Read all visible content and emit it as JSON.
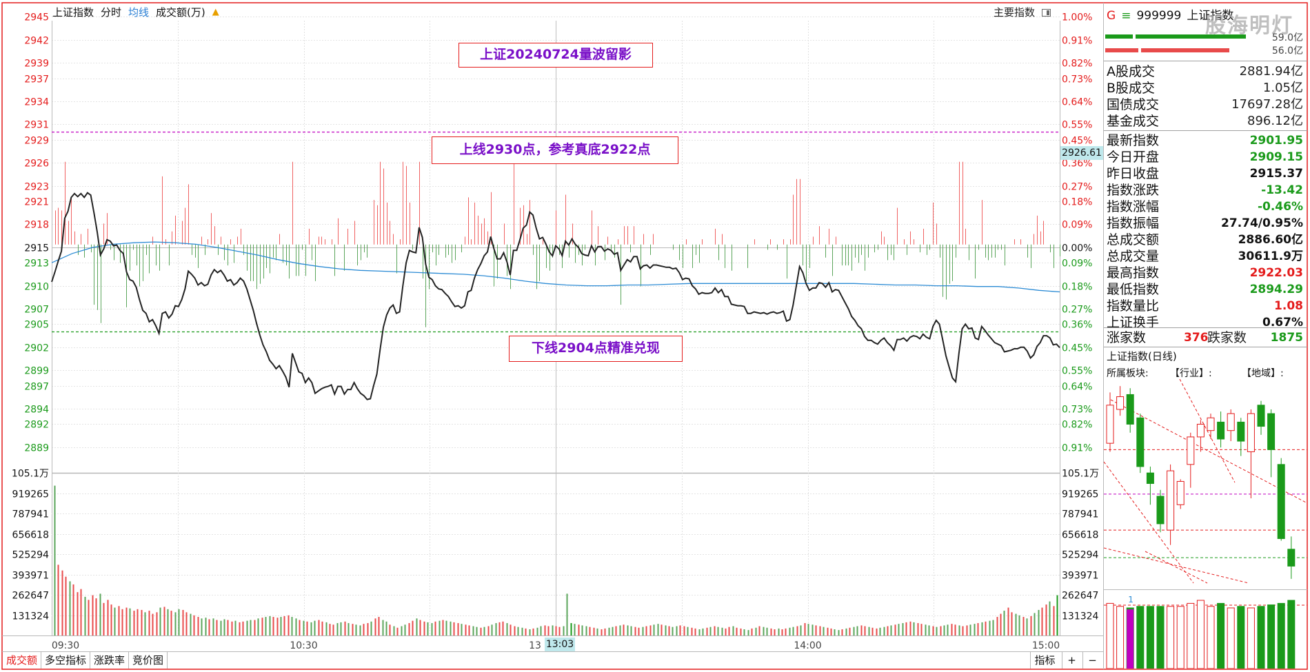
{
  "header": {
    "title": "上证指数",
    "tab_minute": "分时",
    "tab_avg": "均线",
    "tab_volume": "成交额(万)",
    "right_label": "主要指数"
  },
  "annotations": {
    "a1": "上证20240724量波留影",
    "a2": "上线2930点，参考真底2922点",
    "a3": "下线2904点精准兑现"
  },
  "cursor": {
    "price_label": "2926.61",
    "time_label": "13:03"
  },
  "price_ticks": [
    "2945",
    "2942",
    "2939",
    "2937",
    "2934",
    "2931",
    "2929",
    "2926",
    "2923",
    "2921",
    "2918",
    "2915",
    "2913",
    "2910",
    "2907",
    "2905",
    "2902",
    "2899",
    "2897",
    "2894",
    "2892",
    "2889"
  ],
  "pct_ticks": [
    "1.00%",
    "0.91%",
    "0.82%",
    "0.73%",
    "0.64%",
    "0.55%",
    "0.45%",
    "0.36%",
    "0.27%",
    "0.18%",
    "0.09%",
    "0.00%",
    "0.09%",
    "0.18%",
    "0.27%",
    "0.36%",
    "0.45%",
    "0.55%",
    "0.64%",
    "0.73%",
    "0.82%",
    "0.91%"
  ],
  "volume_ticks": [
    "105.1万",
    "919265",
    "787941",
    "656618",
    "525294",
    "393971",
    "262647",
    "131324"
  ],
  "time_ticks": [
    "09:30",
    "10:30",
    "13",
    "14:00",
    "15:00"
  ],
  "chart_data": {
    "type": "line",
    "title": "上证指数",
    "prev_close": 2915.37,
    "ylim": [
      2887.0,
      2944.5
    ],
    "volume_max": 1051000,
    "x_sessions": "09:30-11:30, 13:00-15:00",
    "upper_line": 2930,
    "lower_line": 2904,
    "series": [
      {
        "name": "分时",
        "values": [
          2910.5,
          2911.8,
          2913.2,
          2914.5,
          2918.8,
          2919.7,
          2921.5,
          2922.0,
          2921.6,
          2922.0,
          2921.5,
          2922.1,
          2921.8,
          2919.5,
          2917.0,
          2914.0,
          2914.8,
          2916.0,
          2915.8,
          2915.2,
          2915.3,
          2914.6,
          2914.2,
          2911.8,
          2910.8,
          2910.6,
          2909.8,
          2908.2,
          2906.8,
          2906.4,
          2905.3,
          2905.6,
          2904.8,
          2903.8,
          2906.4,
          2906.6,
          2905.8,
          2906.3,
          2907.4,
          2907.3,
          2908.2,
          2909.6,
          2911.9,
          2911.5,
          2911.0,
          2910.1,
          2910.4,
          2910.0,
          2910.2,
          2911.4,
          2912.1,
          2911.7,
          2912.0,
          2911.4,
          2910.6,
          2910.8,
          2910.1,
          2910.4,
          2911.0,
          2910.6,
          2909.6,
          2908.2,
          2906.8,
          2905.1,
          2903.6,
          2902.3,
          2901.4,
          2900.3,
          2899.8,
          2899.2,
          2899.6,
          2898.9,
          2898.1,
          2896.8,
          2901.2,
          2900.0,
          2898.8,
          2898.6,
          2897.4,
          2898.0,
          2897.4,
          2896.0,
          2896.3,
          2896.6,
          2896.8,
          2896.9,
          2897.1,
          2895.9,
          2896.9,
          2896.9,
          2895.9,
          2896.5,
          2896.5,
          2897.4,
          2896.6,
          2896.0,
          2895.7,
          2895.2,
          2895.3,
          2897.0,
          2898.5,
          2901.7,
          2904.6,
          2906.2,
          2907.1,
          2907.5,
          2906.4,
          2906.6,
          2910.0,
          2913.0,
          2914.6,
          2914.4,
          2914.3,
          2917.6,
          2916.3,
          2912.8,
          2911.1,
          2910.8,
          2910.0,
          2909.6,
          2909.5,
          2909.0,
          2908.6,
          2907.9,
          2907.3,
          2907.4,
          2907.1,
          2907.4,
          2909.2,
          2909.4,
          2911.0,
          2912.1,
          2912.9,
          2913.9,
          2914.4,
          2916.4,
          2914.8,
          2913.5,
          2913.5,
          2914.3,
          2913.1,
          2911.4,
          2914.6,
          2914.6,
          2916.0,
          2917.5,
          2917.9,
          2919.6,
          2919.2,
          2917.5,
          2916.1,
          2916.3,
          2915.4,
          2914.4,
          2913.9,
          2915.2,
          2914.8,
          2913.9,
          2915.8,
          2915.3,
          2916.1,
          2915.4,
          2915.0,
          2914.2,
          2914.0,
          2913.9,
          2915.2,
          2914.4,
          2915.1,
          2915.1,
          2914.5,
          2914.8,
          2914.6,
          2914.1,
          2914.3,
          2912.0,
          2912.7,
          2913.4,
          2913.1,
          2913.8,
          2913.8,
          2912.2,
          2912.6,
          2912.7,
          2912.3,
          2912.7,
          2912.7,
          2912.6,
          2912.5,
          2912.4,
          2912.4,
          2912.2,
          2912.3,
          2911.7,
          2910.8,
          2911.0,
          2910.9,
          2910.0,
          2909.6,
          2908.9,
          2909.1,
          2909.0,
          2909.0,
          2909.1,
          2909.7,
          2909.1,
          2909.5,
          2908.6,
          2908.6,
          2907.6,
          2907.5,
          2907.4,
          2907.4,
          2907.3,
          2906.4,
          2906.4,
          2906.6,
          2906.5,
          2906.4,
          2906.5,
          2906.3,
          2906.5,
          2906.6,
          2906.4,
          2906.5,
          2906.7,
          2905.4,
          2905.6,
          2907.5,
          2910.0,
          2912.5,
          2911.7,
          2910.3,
          2909.4,
          2909.7,
          2909.7,
          2910.4,
          2910.3,
          2909.8,
          2910.4,
          2909.2,
          2909.5,
          2909.4,
          2908.6,
          2907.8,
          2907.0,
          2906.0,
          2905.5,
          2904.8,
          2904.4,
          2903.4,
          2902.9,
          2902.9,
          2902.6,
          2902.4,
          2902.9,
          2903.2,
          2902.6,
          2902.2,
          2901.6,
          2903.0,
          2903.0,
          2903.2,
          2902.8,
          2903.3,
          2903.5,
          2903.4,
          2903.1,
          2903.7,
          2903.3,
          2903.1,
          2904.7,
          2905.5,
          2905.0,
          2903.0,
          2900.9,
          2899.4,
          2898.0,
          2897.5,
          2901.2,
          2904.4,
          2905.0,
          2904.4,
          2904.5,
          2903.2,
          2903.0,
          2904.7,
          2904.2,
          2903.6,
          2903.1,
          2902.6,
          2902.4,
          2902.2,
          2901.4,
          2901.5,
          2901.6,
          2901.8,
          2901.8,
          2902.0,
          2902.0,
          2901.5,
          2900.6,
          2901.0,
          2902.1,
          2902.6,
          2903.5,
          2903.5,
          2903.2,
          2902.3,
          2902.4,
          2901.95
        ]
      },
      {
        "name": "均线",
        "values": [
          2913.0,
          2914.2,
          2915.0,
          2915.4,
          2915.6,
          2915.7,
          2915.6,
          2915.4,
          2915.0,
          2914.5,
          2914.0,
          2913.4,
          2912.9,
          2912.5,
          2912.2,
          2912.0,
          2911.9,
          2911.8,
          2911.7,
          2911.6,
          2911.5,
          2911.3,
          2911.0,
          2910.6,
          2910.3,
          2910.1,
          2910.0,
          2910.0,
          2910.1,
          2910.1,
          2910.2,
          2910.3,
          2910.3,
          2910.3,
          2910.3,
          2910.3,
          2910.3,
          2910.3,
          2910.3,
          2910.3,
          2910.2,
          2910.1,
          2910.1,
          2910.0,
          2910.0,
          2909.9,
          2909.9,
          2909.7,
          2909.4,
          2909.2
        ]
      }
    ],
    "volume_values": [
      968000,
      457000,
      420000,
      380000,
      350000,
      330000,
      280000,
      300000,
      250000,
      230000,
      260000,
      240000,
      270000,
      210000,
      230000,
      200000,
      180000,
      190000,
      170000,
      180000,
      175000,
      160000,
      170000,
      165000,
      150000,
      160000,
      140000,
      150000,
      180000,
      185000,
      170000,
      160000,
      150000,
      170000,
      165000,
      150000,
      140000,
      130000,
      120000,
      110000,
      115000,
      105000,
      110000,
      100000,
      95000,
      105000,
      100000,
      90000,
      95000,
      85000,
      90000,
      95000,
      100000,
      100000,
      110000,
      115000,
      120000,
      125000,
      120000,
      115000,
      120000,
      125000,
      130000,
      120000,
      110000,
      100000,
      95000,
      90000,
      85000,
      95000,
      100000,
      90000,
      85000,
      75000,
      70000,
      80000,
      85000,
      90000,
      80000,
      75000,
      70000,
      65000,
      75000,
      80000,
      90000,
      110000,
      120000,
      100000,
      90000,
      70000,
      60000,
      50000,
      60000,
      70000,
      80000,
      95000,
      110000,
      100000,
      90000,
      85000,
      80000,
      90000,
      95000,
      100000,
      95000,
      90000,
      85000,
      80000,
      75000,
      70000,
      65000,
      60000,
      55000,
      50000,
      55000,
      60000,
      70000,
      80000,
      85000,
      90000,
      80000,
      70000,
      60000,
      55000,
      50000,
      45000,
      40000,
      45000,
      50000,
      60000,
      65000,
      60000,
      65000,
      60000,
      55000,
      60000,
      270000,
      80000,
      75000,
      70000,
      65000,
      60000,
      55000,
      50000,
      45000,
      40000,
      45000,
      50000,
      55000,
      60000,
      65000,
      70000,
      65000,
      60000,
      55000,
      50000,
      55000,
      60000,
      65000,
      70000,
      75000,
      70000,
      65000,
      60000,
      55000,
      60000,
      65000,
      60000,
      55000,
      50000,
      45000,
      40000,
      45000,
      50000,
      55000,
      60000,
      55000,
      50000,
      45000,
      55000,
      60000,
      50000,
      45000,
      40000,
      35000,
      45000,
      50000,
      60000,
      55000,
      50000,
      45000,
      40000,
      45000,
      40000,
      45000,
      50000,
      55000,
      60000,
      65000,
      80000,
      75000,
      70000,
      65000,
      60000,
      55000,
      50000,
      45000,
      40000,
      35000,
      40000,
      45000,
      50000,
      55000,
      60000,
      65000,
      60000,
      55000,
      50000,
      45000,
      50000,
      55000,
      60000,
      65000,
      70000,
      75000,
      80000,
      85000,
      90000,
      85000,
      80000,
      75000,
      70000,
      65000,
      60000,
      55000,
      60000,
      65000,
      70000,
      75000,
      70000,
      65000,
      60000,
      65000,
      70000,
      75000,
      80000,
      85000,
      90000,
      95000,
      100000,
      120000,
      140000,
      160000,
      180000,
      150000,
      140000,
      130000,
      120000,
      110000,
      125000,
      145000,
      165000,
      180000,
      200000,
      220000,
      190000,
      260000
    ]
  },
  "right_panel": {
    "code_prefix": "G",
    "code_icon": "≡",
    "code": "999999",
    "name": "上证指数",
    "bar_value_top": "59.0亿",
    "bar_value_bottom": "56.0亿",
    "rows1": [
      {
        "label": "A股成交",
        "value": "2881.94亿"
      },
      {
        "label": "B股成交",
        "value": "1.05亿"
      },
      {
        "label": "国债成交",
        "value": "17697.28亿"
      },
      {
        "label": "基金成交",
        "value": "896.12亿"
      }
    ],
    "rows2": [
      {
        "label": "最新指数",
        "value": "2901.95",
        "color": "#1a9a1a"
      },
      {
        "label": "今日开盘",
        "value": "2909.15",
        "color": "#1a9a1a"
      },
      {
        "label": "昨日收盘",
        "value": "2915.37",
        "color": "#111111"
      },
      {
        "label": "指数涨跌",
        "value": "-13.42",
        "color": "#1a9a1a"
      },
      {
        "label": "指数涨幅",
        "value": "-0.46%",
        "color": "#1a9a1a"
      },
      {
        "label": "指数振幅",
        "value": "27.74/0.95%",
        "color": "#111111"
      },
      {
        "label": "总成交额",
        "value": "2886.60亿",
        "color": "#111111"
      },
      {
        "label": "总成交量",
        "value": "30611.9万",
        "color": "#111111"
      },
      {
        "label": "最高指数",
        "value": "2922.03",
        "color": "#e41b1b"
      },
      {
        "label": "最低指数",
        "value": "2894.29",
        "color": "#1a9a1a"
      },
      {
        "label": "指数量比",
        "value": "1.08",
        "color": "#e41b1b"
      },
      {
        "label": "上证换手",
        "value": "0.67%",
        "color": "#111111"
      }
    ],
    "up_label": "涨家数",
    "up_value": "376",
    "down_label": "跌家数",
    "down_value": "1875",
    "daily_title": "上证指数(日线)",
    "sector_label": "所属板块:",
    "industry_label": "【行业】:",
    "region_label": "【地域】:",
    "vol_marker": "1",
    "watermark": "股海明灯"
  },
  "candles": [
    {
      "o": 2916,
      "c": 2934,
      "h": 2940,
      "l": 2912
    },
    {
      "o": 2932,
      "c": 2938,
      "h": 2943,
      "l": 2929
    },
    {
      "o": 2939,
      "c": 2925,
      "h": 2942,
      "l": 2921
    },
    {
      "o": 2928,
      "c": 2905,
      "h": 2930,
      "l": 2902
    },
    {
      "o": 2902,
      "c": 2897,
      "h": 2905,
      "l": 2887
    },
    {
      "o": 2891,
      "c": 2878,
      "h": 2894,
      "l": 2874
    },
    {
      "o": 2875,
      "c": 2903,
      "h": 2906,
      "l": 2868
    },
    {
      "o": 2887,
      "c": 2898,
      "h": 2899,
      "l": 2885
    },
    {
      "o": 2906,
      "c": 2919,
      "h": 2921,
      "l": 2895
    },
    {
      "o": 2919,
      "c": 2925,
      "h": 2927,
      "l": 2912
    },
    {
      "o": 2922,
      "c": 2928,
      "h": 2930,
      "l": 2918
    },
    {
      "o": 2926,
      "c": 2918,
      "h": 2931,
      "l": 2914
    },
    {
      "o": 2922,
      "c": 2930,
      "h": 2932,
      "l": 2917
    },
    {
      "o": 2926,
      "c": 2917,
      "h": 2928,
      "l": 2910
    },
    {
      "o": 2912,
      "c": 2930,
      "h": 2932,
      "l": 2890
    },
    {
      "o": 2934,
      "c": 2924,
      "h": 2936,
      "l": 2920
    },
    {
      "o": 2930,
      "c": 2913,
      "h": 2932,
      "l": 2900
    },
    {
      "o": 2906,
      "c": 2871,
      "h": 2909,
      "l": 2870
    },
    {
      "o": 2866,
      "c": 2858,
      "h": 2872,
      "l": 2852
    }
  ],
  "candle_volumes": [
    0.86,
    0.82,
    0.8,
    0.82,
    0.82,
    0.82,
    0.82,
    0.82,
    0.86,
    0.9,
    0.82,
    0.86,
    0.8,
    0.82,
    0.8,
    0.82,
    0.84,
    0.86,
    0.9
  ],
  "bottom_tabs": [
    "成交额",
    "多空指标",
    "涨跌率",
    "竞价图"
  ],
  "bottom_right": {
    "indicator": "指标",
    "plus": "+",
    "minus": "−"
  }
}
